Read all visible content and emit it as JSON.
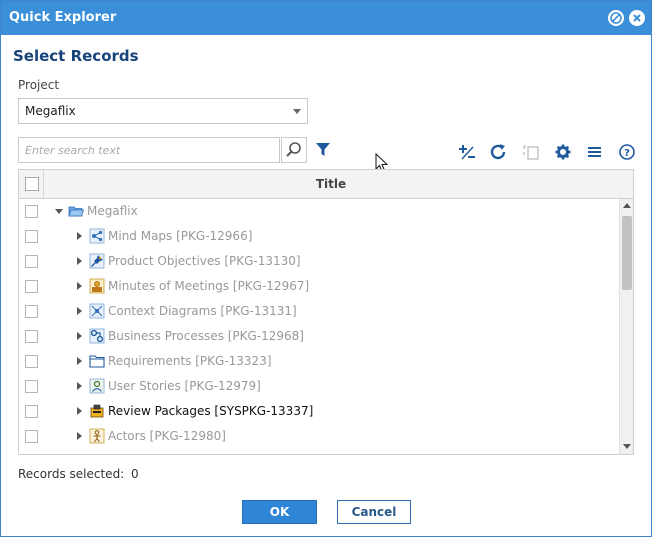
{
  "window": {
    "title": "Quick Explorer"
  },
  "dialog": {
    "heading": "Select Records",
    "project_label": "Project",
    "project_value": "Megaflix",
    "search_placeholder": "Enter search text",
    "grid_header": "Title",
    "root": {
      "label": "Megaflix",
      "icon": "folder-open-icon",
      "expanded": true
    },
    "items": [
      {
        "label": "Mind Maps [PKG-12966]",
        "icon": "mind-map-icon",
        "active": false
      },
      {
        "label": "Product Objectives [PKG-13130]",
        "icon": "pin-icon",
        "active": false
      },
      {
        "label": "Minutes of Meetings [PKG-12967]",
        "icon": "meeting-icon",
        "active": false
      },
      {
        "label": "Context Diagrams [PKG-13131]",
        "icon": "context-diagram-icon",
        "active": false
      },
      {
        "label": "Business Processes [PKG-12968]",
        "icon": "process-icon",
        "active": false
      },
      {
        "label": "Requirements [PKG-13323]",
        "icon": "folder-icon",
        "active": false
      },
      {
        "label": "User Stories [PKG-12979]",
        "icon": "user-story-icon",
        "active": false
      },
      {
        "label": "Review Packages [SYSPKG-13337]",
        "icon": "review-package-icon",
        "active": true
      },
      {
        "label": "Actors [PKG-12980]",
        "icon": "actor-icon",
        "active": false
      }
    ],
    "records_selected_label": "Records selected:",
    "records_selected_count": "0",
    "ok_label": "OK",
    "cancel_label": "Cancel"
  },
  "colors": {
    "titlebar": "#3b8fd8",
    "heading": "#15437a",
    "toolbar_icon": "#1f5a9e",
    "ok_button": "#2f86d6"
  }
}
